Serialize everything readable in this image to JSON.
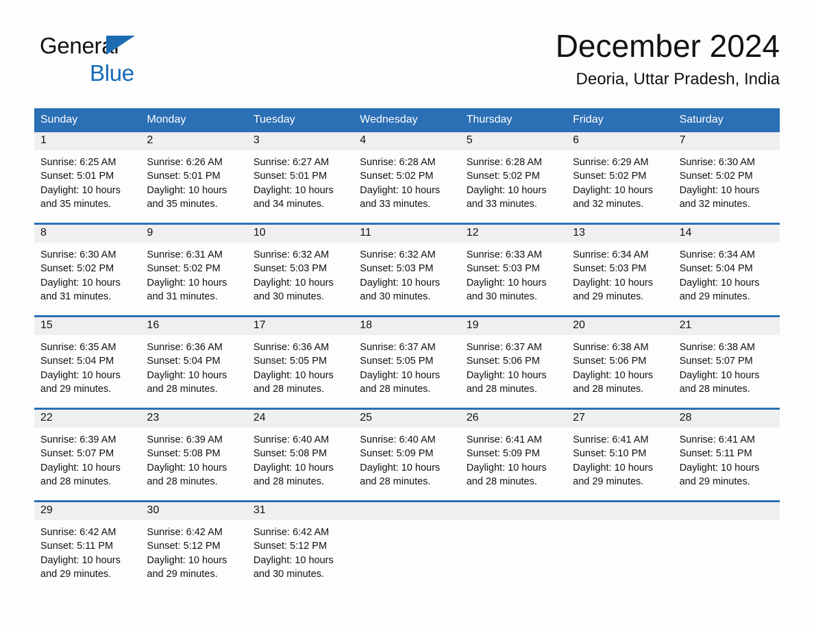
{
  "brand": {
    "line1": "General",
    "line2": "Blue",
    "flag_icon": "triangle-flag-icon",
    "accent_color": "#1569b9"
  },
  "header": {
    "month_title": "December 2024",
    "location": "Deoria, Uttar Pradesh, India"
  },
  "theme": {
    "header_blue": "#2b6fb5",
    "row_divider_blue": "#2b6fb5",
    "day_band_gray": "#efefef",
    "page_background": "#fdfdfd",
    "text_color": "#111111"
  },
  "weekdays": [
    "Sunday",
    "Monday",
    "Tuesday",
    "Wednesday",
    "Thursday",
    "Friday",
    "Saturday"
  ],
  "weeks": [
    [
      {
        "day": "1",
        "sunrise": "Sunrise: 6:25 AM",
        "sunset": "Sunset: 5:01 PM",
        "daylight1": "Daylight: 10 hours",
        "daylight2": "and 35 minutes."
      },
      {
        "day": "2",
        "sunrise": "Sunrise: 6:26 AM",
        "sunset": "Sunset: 5:01 PM",
        "daylight1": "Daylight: 10 hours",
        "daylight2": "and 35 minutes."
      },
      {
        "day": "3",
        "sunrise": "Sunrise: 6:27 AM",
        "sunset": "Sunset: 5:01 PM",
        "daylight1": "Daylight: 10 hours",
        "daylight2": "and 34 minutes."
      },
      {
        "day": "4",
        "sunrise": "Sunrise: 6:28 AM",
        "sunset": "Sunset: 5:02 PM",
        "daylight1": "Daylight: 10 hours",
        "daylight2": "and 33 minutes."
      },
      {
        "day": "5",
        "sunrise": "Sunrise: 6:28 AM",
        "sunset": "Sunset: 5:02 PM",
        "daylight1": "Daylight: 10 hours",
        "daylight2": "and 33 minutes."
      },
      {
        "day": "6",
        "sunrise": "Sunrise: 6:29 AM",
        "sunset": "Sunset: 5:02 PM",
        "daylight1": "Daylight: 10 hours",
        "daylight2": "and 32 minutes."
      },
      {
        "day": "7",
        "sunrise": "Sunrise: 6:30 AM",
        "sunset": "Sunset: 5:02 PM",
        "daylight1": "Daylight: 10 hours",
        "daylight2": "and 32 minutes."
      }
    ],
    [
      {
        "day": "8",
        "sunrise": "Sunrise: 6:30 AM",
        "sunset": "Sunset: 5:02 PM",
        "daylight1": "Daylight: 10 hours",
        "daylight2": "and 31 minutes."
      },
      {
        "day": "9",
        "sunrise": "Sunrise: 6:31 AM",
        "sunset": "Sunset: 5:02 PM",
        "daylight1": "Daylight: 10 hours",
        "daylight2": "and 31 minutes."
      },
      {
        "day": "10",
        "sunrise": "Sunrise: 6:32 AM",
        "sunset": "Sunset: 5:03 PM",
        "daylight1": "Daylight: 10 hours",
        "daylight2": "and 30 minutes."
      },
      {
        "day": "11",
        "sunrise": "Sunrise: 6:32 AM",
        "sunset": "Sunset: 5:03 PM",
        "daylight1": "Daylight: 10 hours",
        "daylight2": "and 30 minutes."
      },
      {
        "day": "12",
        "sunrise": "Sunrise: 6:33 AM",
        "sunset": "Sunset: 5:03 PM",
        "daylight1": "Daylight: 10 hours",
        "daylight2": "and 30 minutes."
      },
      {
        "day": "13",
        "sunrise": "Sunrise: 6:34 AM",
        "sunset": "Sunset: 5:03 PM",
        "daylight1": "Daylight: 10 hours",
        "daylight2": "and 29 minutes."
      },
      {
        "day": "14",
        "sunrise": "Sunrise: 6:34 AM",
        "sunset": "Sunset: 5:04 PM",
        "daylight1": "Daylight: 10 hours",
        "daylight2": "and 29 minutes."
      }
    ],
    [
      {
        "day": "15",
        "sunrise": "Sunrise: 6:35 AM",
        "sunset": "Sunset: 5:04 PM",
        "daylight1": "Daylight: 10 hours",
        "daylight2": "and 29 minutes."
      },
      {
        "day": "16",
        "sunrise": "Sunrise: 6:36 AM",
        "sunset": "Sunset: 5:04 PM",
        "daylight1": "Daylight: 10 hours",
        "daylight2": "and 28 minutes."
      },
      {
        "day": "17",
        "sunrise": "Sunrise: 6:36 AM",
        "sunset": "Sunset: 5:05 PM",
        "daylight1": "Daylight: 10 hours",
        "daylight2": "and 28 minutes."
      },
      {
        "day": "18",
        "sunrise": "Sunrise: 6:37 AM",
        "sunset": "Sunset: 5:05 PM",
        "daylight1": "Daylight: 10 hours",
        "daylight2": "and 28 minutes."
      },
      {
        "day": "19",
        "sunrise": "Sunrise: 6:37 AM",
        "sunset": "Sunset: 5:06 PM",
        "daylight1": "Daylight: 10 hours",
        "daylight2": "and 28 minutes."
      },
      {
        "day": "20",
        "sunrise": "Sunrise: 6:38 AM",
        "sunset": "Sunset: 5:06 PM",
        "daylight1": "Daylight: 10 hours",
        "daylight2": "and 28 minutes."
      },
      {
        "day": "21",
        "sunrise": "Sunrise: 6:38 AM",
        "sunset": "Sunset: 5:07 PM",
        "daylight1": "Daylight: 10 hours",
        "daylight2": "and 28 minutes."
      }
    ],
    [
      {
        "day": "22",
        "sunrise": "Sunrise: 6:39 AM",
        "sunset": "Sunset: 5:07 PM",
        "daylight1": "Daylight: 10 hours",
        "daylight2": "and 28 minutes."
      },
      {
        "day": "23",
        "sunrise": "Sunrise: 6:39 AM",
        "sunset": "Sunset: 5:08 PM",
        "daylight1": "Daylight: 10 hours",
        "daylight2": "and 28 minutes."
      },
      {
        "day": "24",
        "sunrise": "Sunrise: 6:40 AM",
        "sunset": "Sunset: 5:08 PM",
        "daylight1": "Daylight: 10 hours",
        "daylight2": "and 28 minutes."
      },
      {
        "day": "25",
        "sunrise": "Sunrise: 6:40 AM",
        "sunset": "Sunset: 5:09 PM",
        "daylight1": "Daylight: 10 hours",
        "daylight2": "and 28 minutes."
      },
      {
        "day": "26",
        "sunrise": "Sunrise: 6:41 AM",
        "sunset": "Sunset: 5:09 PM",
        "daylight1": "Daylight: 10 hours",
        "daylight2": "and 28 minutes."
      },
      {
        "day": "27",
        "sunrise": "Sunrise: 6:41 AM",
        "sunset": "Sunset: 5:10 PM",
        "daylight1": "Daylight: 10 hours",
        "daylight2": "and 29 minutes."
      },
      {
        "day": "28",
        "sunrise": "Sunrise: 6:41 AM",
        "sunset": "Sunset: 5:11 PM",
        "daylight1": "Daylight: 10 hours",
        "daylight2": "and 29 minutes."
      }
    ],
    [
      {
        "day": "29",
        "sunrise": "Sunrise: 6:42 AM",
        "sunset": "Sunset: 5:11 PM",
        "daylight1": "Daylight: 10 hours",
        "daylight2": "and 29 minutes."
      },
      {
        "day": "30",
        "sunrise": "Sunrise: 6:42 AM",
        "sunset": "Sunset: 5:12 PM",
        "daylight1": "Daylight: 10 hours",
        "daylight2": "and 29 minutes."
      },
      {
        "day": "31",
        "sunrise": "Sunrise: 6:42 AM",
        "sunset": "Sunset: 5:12 PM",
        "daylight1": "Daylight: 10 hours",
        "daylight2": "and 30 minutes."
      },
      {
        "day": "",
        "sunrise": "",
        "sunset": "",
        "daylight1": "",
        "daylight2": ""
      },
      {
        "day": "",
        "sunrise": "",
        "sunset": "",
        "daylight1": "",
        "daylight2": ""
      },
      {
        "day": "",
        "sunrise": "",
        "sunset": "",
        "daylight1": "",
        "daylight2": ""
      },
      {
        "day": "",
        "sunrise": "",
        "sunset": "",
        "daylight1": "",
        "daylight2": ""
      }
    ]
  ]
}
